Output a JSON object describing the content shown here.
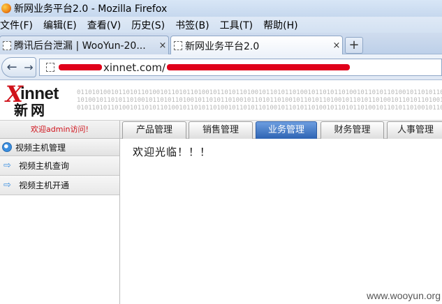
{
  "window": {
    "title": "新网业务平台2.0 - Mozilla Firefox"
  },
  "menubar": {
    "items": [
      "文件(F)",
      "编辑(E)",
      "查看(V)",
      "历史(S)",
      "书签(B)",
      "工具(T)",
      "帮助(H)"
    ]
  },
  "tabs": [
    {
      "label": "腾讯后台泄漏 | WooYun-20...",
      "close": "×",
      "active": false
    },
    {
      "label": "新网业务平台2.0",
      "close": "×",
      "active": true
    }
  ],
  "newtab": {
    "label": "+"
  },
  "nav": {
    "back_icon": "back-arrow-icon",
    "forward_icon": "forward-arrow-icon",
    "url_visible": "xinnet.com/"
  },
  "site": {
    "logo_x": "X",
    "logo_innet": "innet",
    "logo_cn": "新网",
    "binary_lines": [
      "0110101001011010110100101101011010010110101101001011010110100101101011010010110101101001011010110100101101011010010110101101001011010",
      "1010010110101101001011010110100101101011010010110101101001011010110100101101011010010110101101001011010110100101101011010010110101101",
      "0101101011010010110101101001011010110100101101011010010110101101001011010110100101101011010010110101101001011010110100101101011010010"
    ]
  },
  "header_nav": {
    "welcome": "欢迎admin访问!",
    "tabs": [
      "产品管理",
      "销售管理",
      "业务管理",
      "财务管理",
      "人事管理"
    ],
    "active_index": 2
  },
  "leftmenu": {
    "header": "视频主机管理",
    "items": [
      "视频主机查询",
      "视频主机开通"
    ]
  },
  "content": {
    "message": "欢迎光临！！！"
  },
  "watermark": "www.wooyun.org",
  "colors": {
    "accent_red": "#d0121b",
    "active_tab_blue": "#2d63b3",
    "redaction": "#e0001a"
  }
}
